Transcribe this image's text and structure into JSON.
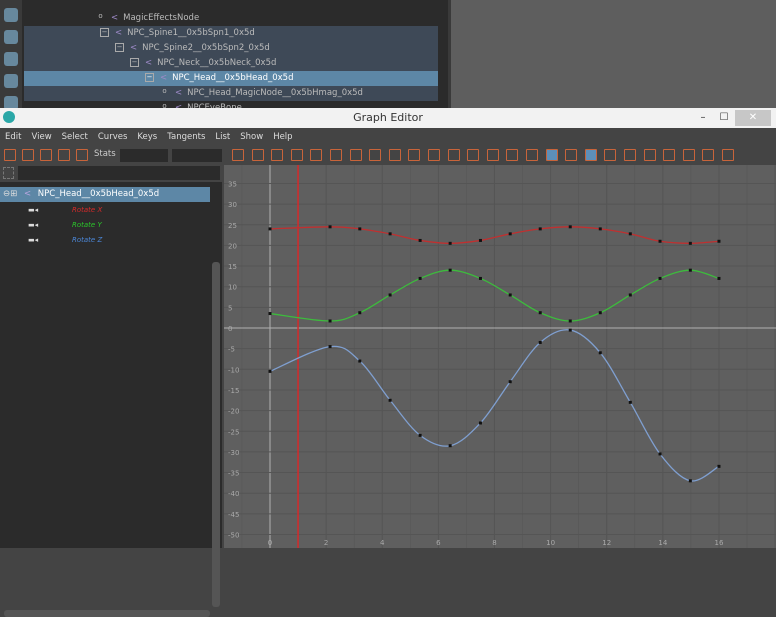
{
  "outliner": {
    "rows": [
      {
        "label": "MagicEffectsNode",
        "indent": 96,
        "state": "",
        "exp": "o"
      },
      {
        "label": "NPC_Spine1__0x5bSpn1_0x5d",
        "indent": 100,
        "state": "hl",
        "exp": "−"
      },
      {
        "label": "NPC_Spine2__0x5bSpn2_0x5d",
        "indent": 115,
        "state": "hl",
        "exp": "−"
      },
      {
        "label": "NPC_Neck__0x5bNeck_0x5d",
        "indent": 130,
        "state": "hl",
        "exp": "−"
      },
      {
        "label": "NPC_Head__0x5bHead_0x5d",
        "indent": 145,
        "state": "sel",
        "exp": "−"
      },
      {
        "label": "NPC_Head_MagicNode__0x5bHmag_0x5d",
        "indent": 160,
        "state": "hl",
        "exp": "o"
      },
      {
        "label": "NPCEyeBone",
        "indent": 160,
        "state": "",
        "exp": "o"
      }
    ]
  },
  "window": {
    "title": "Graph Editor",
    "minimize": "–",
    "maximize": "☐",
    "close": "✕"
  },
  "menu": [
    "Edit",
    "View",
    "Select",
    "Curves",
    "Keys",
    "Tangents",
    "List",
    "Show",
    "Help"
  ],
  "toolbar": {
    "stats_label": "Stats",
    "left_icons": [
      "move-key-icon",
      "insert-key-icon",
      "lattice-icon",
      "region-select-icon",
      "retime-icon"
    ],
    "right_icons": [
      "frame-all-icon",
      "frame-playback-icon",
      "center-current-icon",
      "auto-tangent-icon",
      "spline-tangent-icon",
      "clamped-tangent-icon",
      "linear-tangent-icon",
      "flat-tangent-icon",
      "step-tangent-icon",
      "plateau-tangent-icon",
      "buffer-curve-icon",
      "swap-buffer-icon",
      "break-tangent-icon",
      "unify-tangent-icon",
      "free-weight-icon",
      "lock-weight-icon",
      "curve-display-icon",
      "normalize-icon",
      "time-snap-icon",
      "value-snap-icon",
      "pre-infinity-icon",
      "post-infinity-icon",
      "cycle-icon",
      "isolate-icon",
      "dope-sheet-icon",
      "trax-icon"
    ],
    "active": [
      "curve-display-icon",
      "time-snap-icon"
    ]
  },
  "panel": {
    "node": "NPC_Head__0x5bHead_0x5d",
    "channels": [
      {
        "label": "Rotate X",
        "color": "#d42a2a"
      },
      {
        "label": "Rotate Y",
        "color": "#2bc42b"
      },
      {
        "label": "Rotate Z",
        "color": "#4b86d6"
      }
    ]
  },
  "chart_data": {
    "type": "line",
    "xlim": [
      0,
      16
    ],
    "ylim": [
      -50,
      35
    ],
    "x_ticks": [
      0,
      2,
      4,
      6,
      8,
      10,
      12,
      14,
      16
    ],
    "y_ticks": [
      35,
      30,
      25,
      20,
      15,
      10,
      5,
      0,
      -5,
      -10,
      -15,
      -20,
      -25,
      -30,
      -35,
      -40,
      -45,
      -50
    ],
    "current_time": 1,
    "current_time_color": "#d42a2a",
    "grid": true,
    "series": [
      {
        "name": "Rotate X",
        "color": "#c03030",
        "keys": [
          [
            0,
            24
          ],
          [
            2.14,
            24.5
          ],
          [
            3.2,
            24
          ],
          [
            4.28,
            22.8
          ],
          [
            5.35,
            21.2
          ],
          [
            6.42,
            20.5
          ],
          [
            7.5,
            21.2
          ],
          [
            8.56,
            22.8
          ],
          [
            9.63,
            24
          ],
          [
            10.7,
            24.5
          ],
          [
            11.77,
            24
          ],
          [
            12.84,
            22.8
          ],
          [
            13.9,
            21
          ],
          [
            14.98,
            20.5
          ],
          [
            16,
            21
          ]
        ]
      },
      {
        "name": "Rotate Y",
        "color": "#3dbb3d",
        "keys": [
          [
            0,
            3.5
          ],
          [
            2.14,
            1.7
          ],
          [
            3.2,
            3.7
          ],
          [
            4.28,
            8
          ],
          [
            5.35,
            12
          ],
          [
            6.42,
            14
          ],
          [
            7.5,
            12
          ],
          [
            8.56,
            8
          ],
          [
            9.63,
            3.7
          ],
          [
            10.7,
            1.7
          ],
          [
            11.77,
            3.7
          ],
          [
            12.84,
            8
          ],
          [
            13.9,
            12
          ],
          [
            14.98,
            14
          ],
          [
            16,
            12
          ]
        ]
      },
      {
        "name": "Rotate Z",
        "color": "#7f9fd0",
        "keys": [
          [
            0,
            -10.5
          ],
          [
            2.14,
            -4.5
          ],
          [
            3.2,
            -8
          ],
          [
            4.28,
            -17.5
          ],
          [
            5.35,
            -26
          ],
          [
            6.42,
            -28.5
          ],
          [
            7.5,
            -23
          ],
          [
            8.56,
            -13
          ],
          [
            9.63,
            -3.5
          ],
          [
            10.7,
            -0.5
          ],
          [
            11.77,
            -6
          ],
          [
            12.84,
            -18
          ],
          [
            13.9,
            -30.5
          ],
          [
            14.98,
            -37
          ],
          [
            16,
            -33.5
          ]
        ]
      }
    ]
  }
}
